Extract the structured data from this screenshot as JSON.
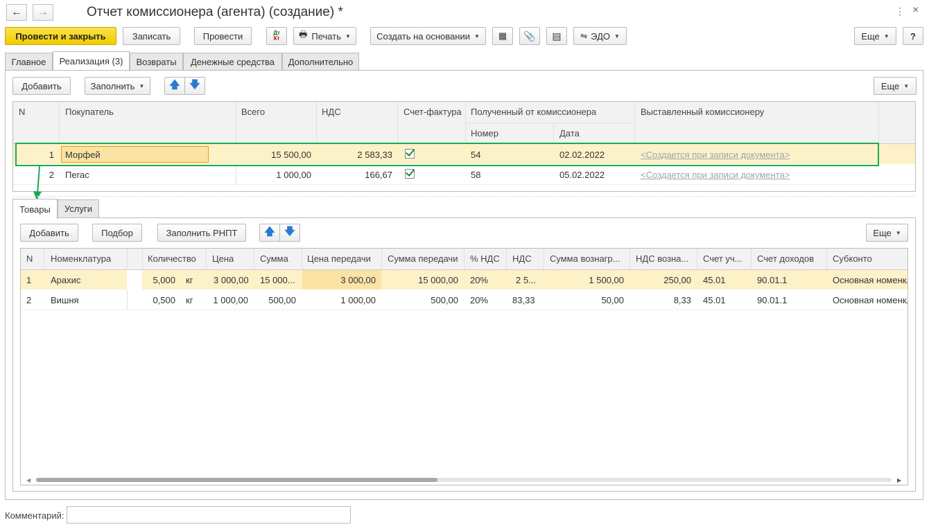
{
  "window": {
    "title": "Отчет комиссионера (агента) (создание) *"
  },
  "toolbar": {
    "post_close": "Провести и закрыть",
    "save": "Записать",
    "post": "Провести",
    "dtkt_top": "Дт",
    "dtkt_bottom": "Кт",
    "print": "Печать",
    "create_based": "Создать на основании",
    "edo": "ЭДО",
    "more": "Еще",
    "help": "?"
  },
  "tabs": [
    "Главное",
    "Реализация (3)",
    "Возвраты",
    "Денежные средства",
    "Дополнительно"
  ],
  "sales": {
    "add": "Добавить",
    "fill": "Заполнить",
    "more": "Еще",
    "headers": {
      "n": "N",
      "buyer": "Покупатель",
      "total": "Всего",
      "vat": "НДС",
      "invoice": "Счет-фактура",
      "received_group": "Полученный от комиссионера",
      "number": "Номер",
      "date": "Дата",
      "issued": "Выставленный комиссионеру"
    },
    "rows": [
      {
        "n": "1",
        "buyer": "Морфей",
        "total": "15 500,00",
        "vat": "2 583,33",
        "invoice": true,
        "number": "54",
        "date": "02.02.2022",
        "issued": "<Создается при записи документа>"
      },
      {
        "n": "2",
        "buyer": "Пегас",
        "total": "1 000,00",
        "vat": "166,67",
        "invoice": true,
        "number": "58",
        "date": "05.02.2022",
        "issued": "<Создается при записи документа>"
      }
    ]
  },
  "subtabs": [
    "Товары",
    "Услуги"
  ],
  "goods": {
    "add": "Добавить",
    "pick": "Подбор",
    "fill_rnpt": "Заполнить РНПТ",
    "more": "Еще",
    "headers": {
      "n": "N",
      "item": "Номенклатура",
      "qty": "Количество",
      "price": "Цена",
      "sum": "Сумма",
      "transfer_price": "Цена передачи",
      "transfer_sum": "Сумма передачи",
      "vat_rate": "% НДС",
      "vat": "НДС",
      "reward_sum": "Сумма вознагр...",
      "reward_vat": "НДС возна...",
      "account": "Счет уч...",
      "income_account": "Счет доходов",
      "subconto": "Субконто"
    },
    "rows": [
      {
        "n": "1",
        "item": "Арахис",
        "qty": "5,000",
        "unit": "кг",
        "price": "3 000,00",
        "sum": "15 000...",
        "transfer_price": "3 000,00",
        "transfer_sum": "15 000,00",
        "vat_rate": "20%",
        "vat": "2 5...",
        "reward_sum": "1 500,00",
        "reward_vat": "250,00",
        "account": "45.01",
        "income_account": "90.01.1",
        "subconto": "Основная номенкл"
      },
      {
        "n": "2",
        "item": "Вишня",
        "qty": "0,500",
        "unit": "кг",
        "price": "1 000,00",
        "sum": "500,00",
        "transfer_price": "1 000,00",
        "transfer_sum": "500,00",
        "vat_rate": "20%",
        "vat": "83,33",
        "reward_sum": "50,00",
        "reward_vat": "8,33",
        "account": "45.01",
        "income_account": "90.01.1",
        "subconto": "Основная номенкл"
      }
    ]
  },
  "comment": {
    "label": "Комментарий:",
    "value": ""
  },
  "colors": {
    "accent_yellow": "#f5d51a",
    "selected_row": "#fdf1c8",
    "highlight_green": "#1aaa55",
    "link_gray": "#9aa4b0"
  }
}
